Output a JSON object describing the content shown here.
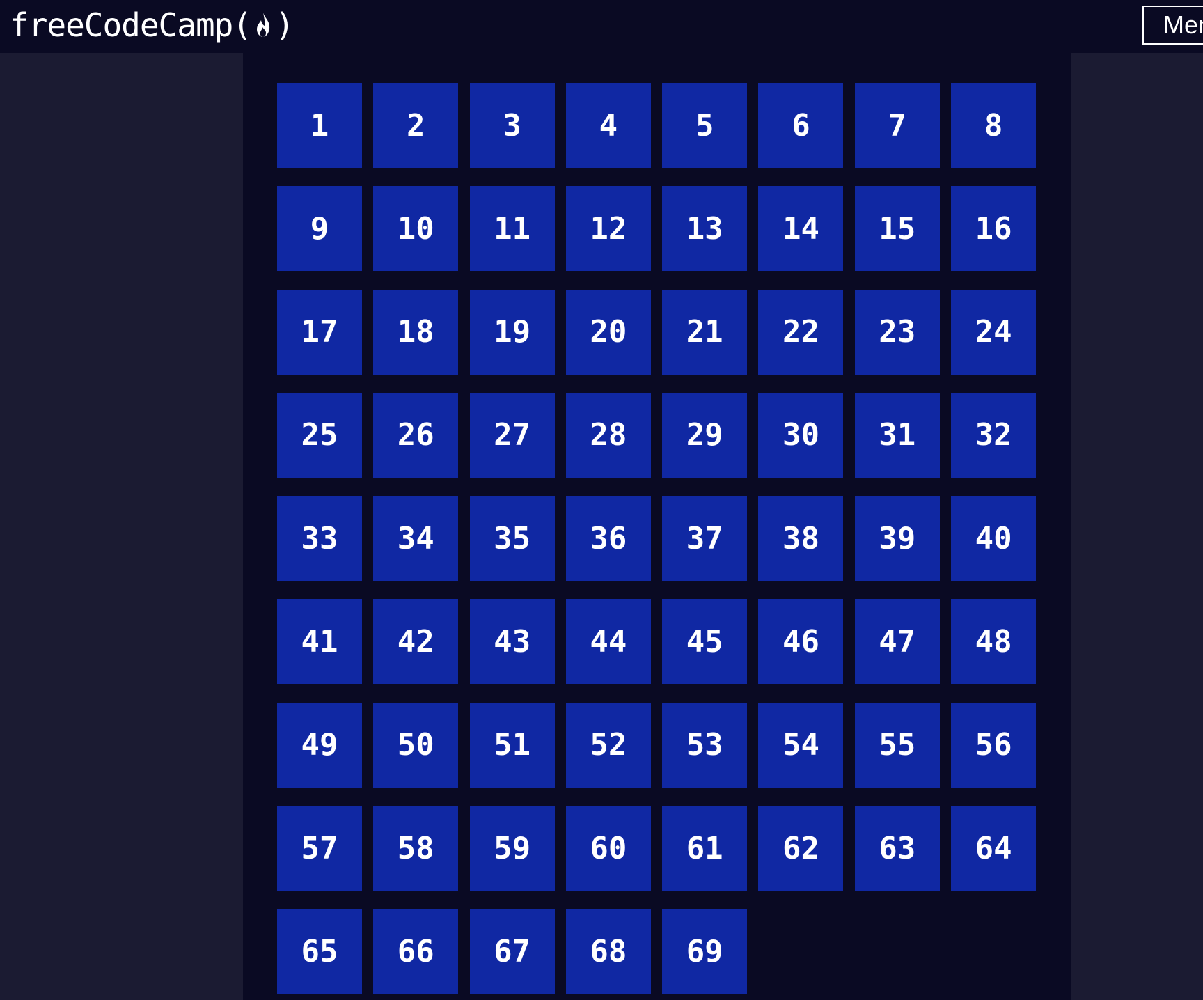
{
  "header": {
    "logo_text_start": "freeCodeCamp(",
    "logo_text_end": ")",
    "logo_icon": "flame-icon",
    "menu_label": "Menu"
  },
  "colors": {
    "navbar_bg": "#0a0a23",
    "page_bg": "#1b1b32",
    "tile_bg": "#1028a3",
    "tile_text": "#ffffff"
  },
  "tiles": [
    "1",
    "2",
    "3",
    "4",
    "5",
    "6",
    "7",
    "8",
    "9",
    "10",
    "11",
    "12",
    "13",
    "14",
    "15",
    "16",
    "17",
    "18",
    "19",
    "20",
    "21",
    "22",
    "23",
    "24",
    "25",
    "26",
    "27",
    "28",
    "29",
    "30",
    "31",
    "32",
    "33",
    "34",
    "35",
    "36",
    "37",
    "38",
    "39",
    "40",
    "41",
    "42",
    "43",
    "44",
    "45",
    "46",
    "47",
    "48",
    "49",
    "50",
    "51",
    "52",
    "53",
    "54",
    "55",
    "56",
    "57",
    "58",
    "59",
    "60",
    "61",
    "62",
    "63",
    "64",
    "65",
    "66",
    "67",
    "68",
    "69"
  ]
}
